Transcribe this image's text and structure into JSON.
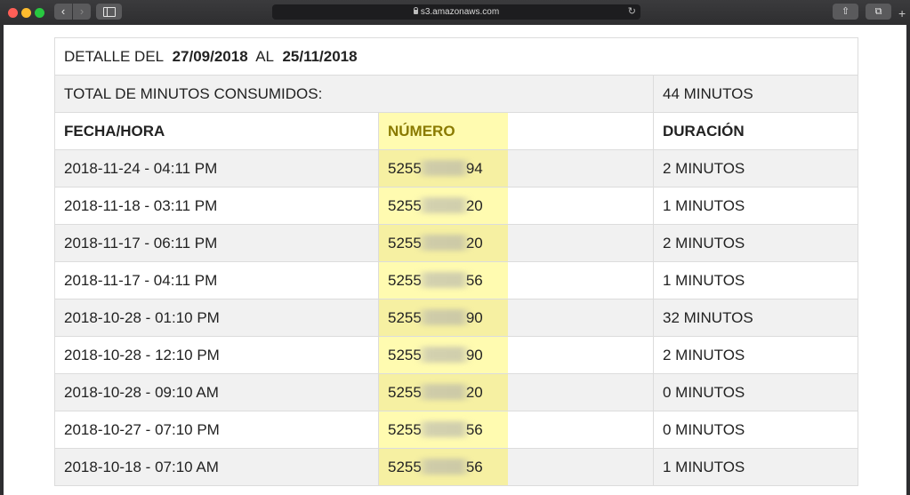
{
  "browser": {
    "url": "s3.amazonaws.com",
    "new_tab": "+"
  },
  "report": {
    "period_label": "DETALLE DEL",
    "start_date": "27/09/2018",
    "between_label": "AL",
    "end_date": "25/11/2018",
    "total_label": "TOTAL DE MINUTOS CONSUMIDOS:",
    "total_value": "44 MINUTOS",
    "columns": [
      "FECHA/HORA",
      "NÚMERO",
      "DURACIÓN"
    ],
    "rows": [
      {
        "datetime": "2018-11-24 - 04:11 PM",
        "number_prefix": "5255",
        "number_suffix": "94",
        "duration": "2 MINUTOS"
      },
      {
        "datetime": "2018-11-18 - 03:11 PM",
        "number_prefix": "5255",
        "number_suffix": "20",
        "duration": "1 MINUTOS"
      },
      {
        "datetime": "2018-11-17 - 06:11 PM",
        "number_prefix": "5255",
        "number_suffix": "20",
        "duration": "2 MINUTOS"
      },
      {
        "datetime": "2018-11-17 - 04:11 PM",
        "number_prefix": "5255",
        "number_suffix": "56",
        "duration": "1 MINUTOS"
      },
      {
        "datetime": "2018-10-28 - 01:10 PM",
        "number_prefix": "5255",
        "number_suffix": "90",
        "duration": "32 MINUTOS"
      },
      {
        "datetime": "2018-10-28 - 12:10 PM",
        "number_prefix": "5255",
        "number_suffix": "90",
        "duration": "2 MINUTOS"
      },
      {
        "datetime": "2018-10-28 - 09:10 AM",
        "number_prefix": "5255",
        "number_suffix": "20",
        "duration": "0 MINUTOS"
      },
      {
        "datetime": "2018-10-27 - 07:10 PM",
        "number_prefix": "5255",
        "number_suffix": "56",
        "duration": "0 MINUTOS"
      },
      {
        "datetime": "2018-10-18 - 07:10 AM",
        "number_prefix": "5255",
        "number_suffix": "56",
        "duration": "1 MINUTOS"
      }
    ]
  }
}
